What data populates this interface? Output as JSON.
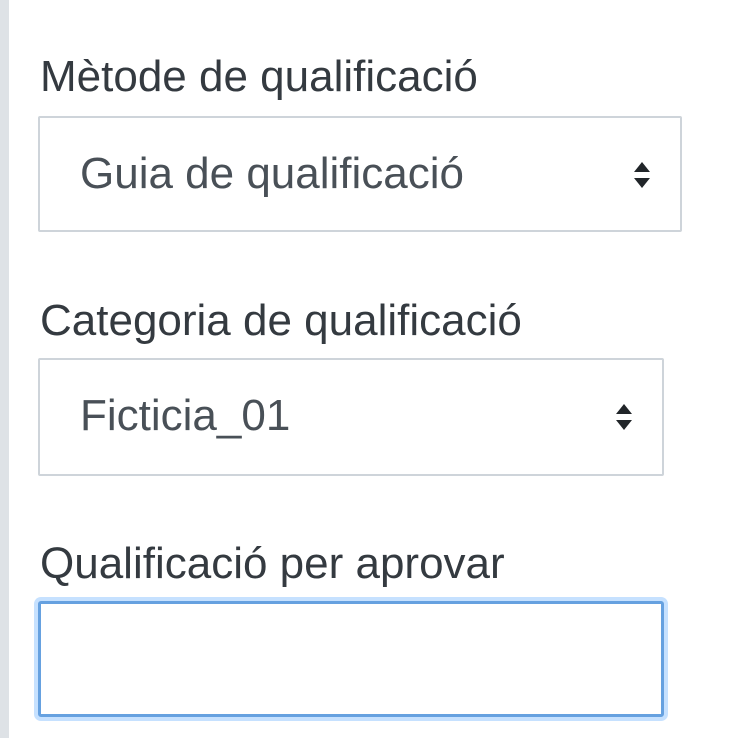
{
  "fields": {
    "grading_method": {
      "label": "Mètode de qualificació",
      "selected": "Guia de qualificació"
    },
    "grade_category": {
      "label": "Categoria de qualificació",
      "selected": "Ficticia_01"
    },
    "grade_to_pass": {
      "label": "Qualificació per aprovar",
      "value": ""
    }
  },
  "icons": {
    "select_arrow": "sort-updown-icon"
  },
  "colors": {
    "label_text": "#343a40",
    "border": "#ced4da",
    "focus_border": "#66a1e0",
    "left_rule": "#dee2e6"
  }
}
